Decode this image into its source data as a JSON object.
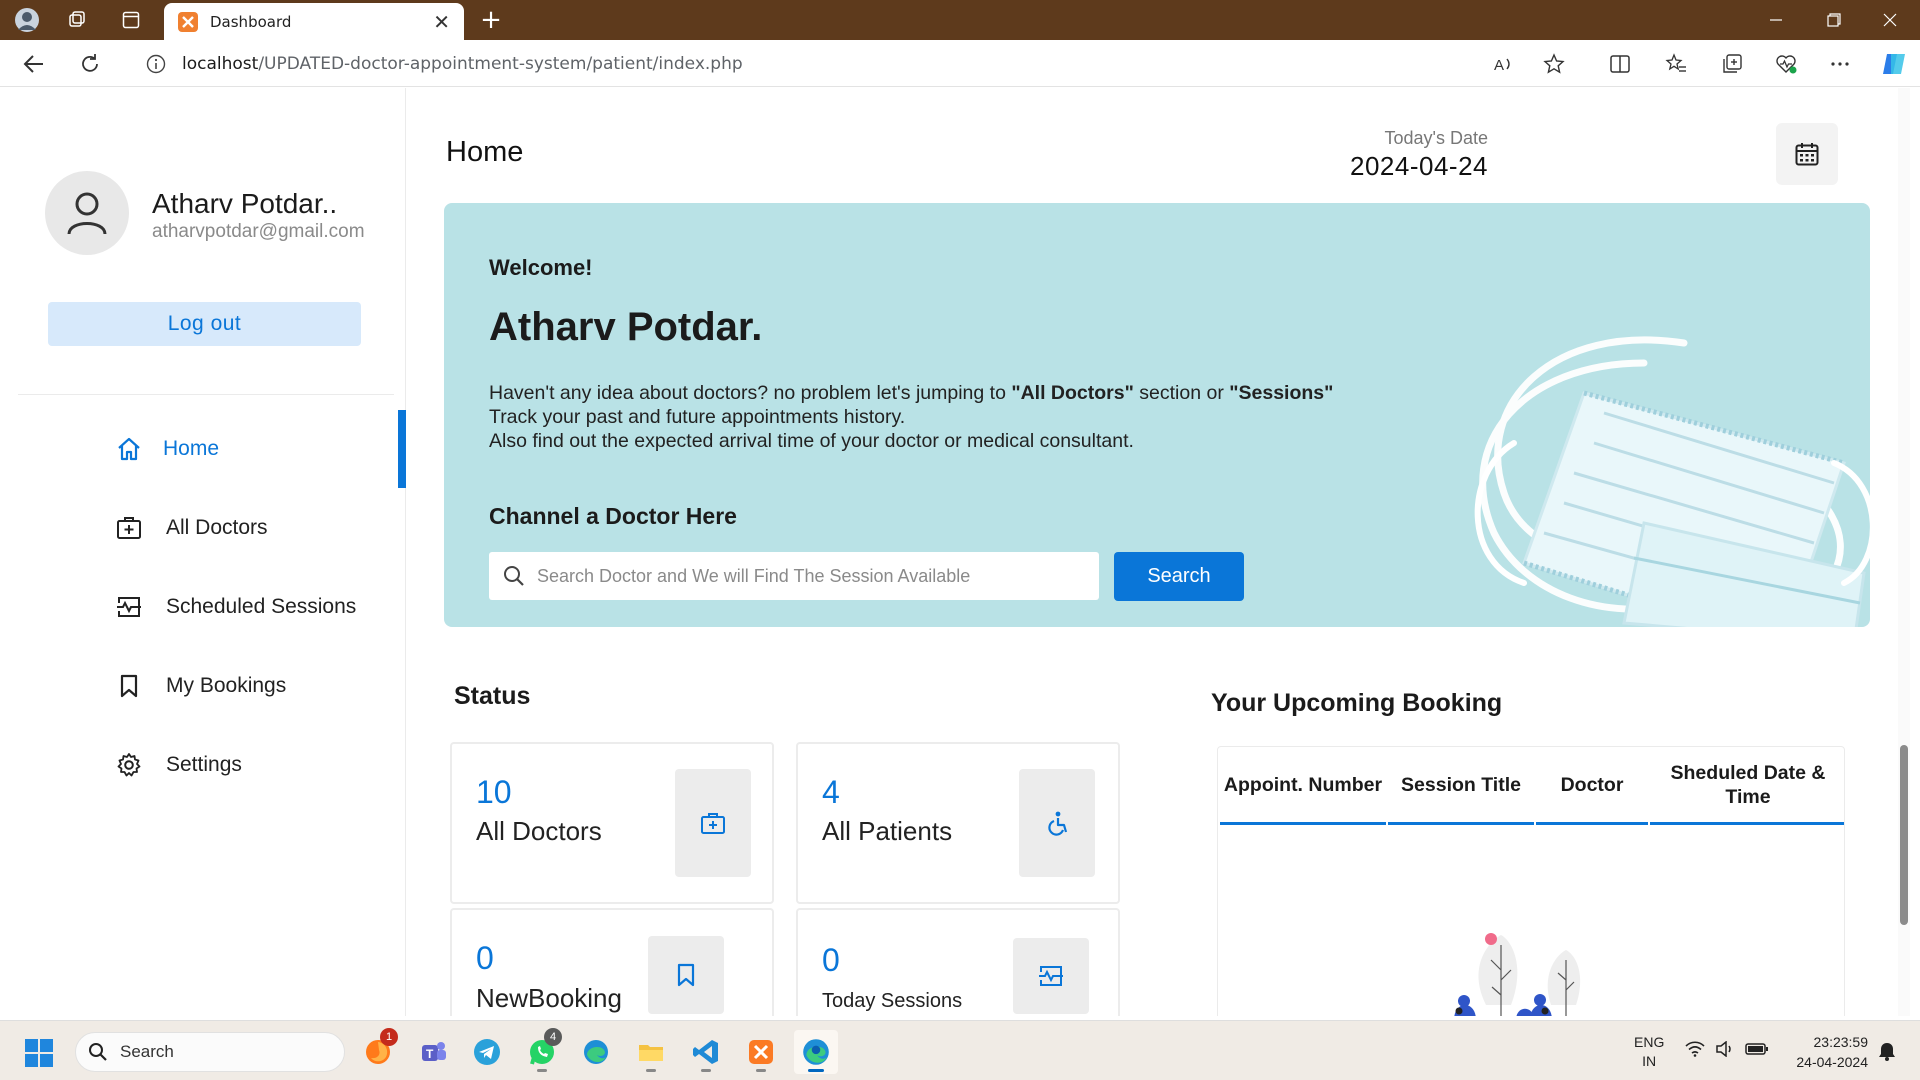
{
  "browser": {
    "tab_title": "Dashboard",
    "url_host": "localhost",
    "url_path": "/UPDATED-doctor-appointment-system/patient/index.php"
  },
  "sidebar": {
    "profile_name": "Atharv Potdar..",
    "profile_email": "atharvpotdar@gmail.com",
    "logout_label": "Log out",
    "menu": [
      {
        "label": "Home",
        "icon": "home-icon",
        "active": true
      },
      {
        "label": "All Doctors",
        "icon": "doctor-bag-icon",
        "active": false
      },
      {
        "label": "Scheduled Sessions",
        "icon": "sessions-icon",
        "active": false
      },
      {
        "label": "My Bookings",
        "icon": "bookmark-icon",
        "active": false
      },
      {
        "label": "Settings",
        "icon": "gear-icon",
        "active": false
      }
    ]
  },
  "header": {
    "title": "Home",
    "date_label": "Today's Date",
    "date_value": "2024-04-24"
  },
  "hero": {
    "welcome": "Welcome!",
    "name": "Atharv Potdar.",
    "line1_pre": "Haven't any idea about doctors? no problem let's jumping to ",
    "line1_b1": "\"All Doctors\"",
    "line1_mid": " section or ",
    "line1_b2": "\"Sessions\"",
    "line2": "Track your past and future appointments history.",
    "line3": "Also find out the expected arrival time of your doctor or medical consultant.",
    "channel_title": "Channel a Doctor Here",
    "search_placeholder": "Search Doctor and We will Find The Session Available",
    "search_button": "Search"
  },
  "status": {
    "title": "Status",
    "cards": [
      {
        "value": "10",
        "label": "All Doctors",
        "icon": "doctor-bag-icon"
      },
      {
        "value": "4",
        "label": "All Patients",
        "icon": "wheelchair-icon"
      },
      {
        "value": "0",
        "label": "NewBooking",
        "icon": "bookmark-icon"
      },
      {
        "value": "0",
        "label": "Today Sessions",
        "icon": "sessions-icon"
      }
    ]
  },
  "upcoming": {
    "title": "Your Upcoming Booking",
    "columns": [
      "Appoint. Number",
      "Session Title",
      "Doctor",
      "Sheduled Date & Time"
    ]
  },
  "taskbar": {
    "search_label": "Search",
    "lang_line1": "ENG",
    "lang_line2": "IN",
    "time": "23:23:59",
    "date": "24-04-2024",
    "badges": {
      "firefox": "1",
      "whatsapp": "4"
    }
  },
  "colors": {
    "accent": "#0a76d8",
    "hero_bg": "#b9e2e6",
    "titlebar": "#5e3a1c"
  }
}
